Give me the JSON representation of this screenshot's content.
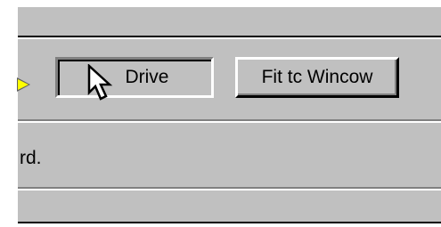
{
  "toolbar": {
    "drive_label": "Drive",
    "fit_label": "Fit tc Wincow"
  },
  "status": {
    "text": "rd."
  },
  "icons": {
    "left_arrow": "play-arrow-icon",
    "cursor": "mouse-pointer-icon"
  },
  "colors": {
    "face": "#c0c0c0",
    "shadow": "#808080",
    "highlight": "#ffffff",
    "arrow": "#ffff00"
  }
}
